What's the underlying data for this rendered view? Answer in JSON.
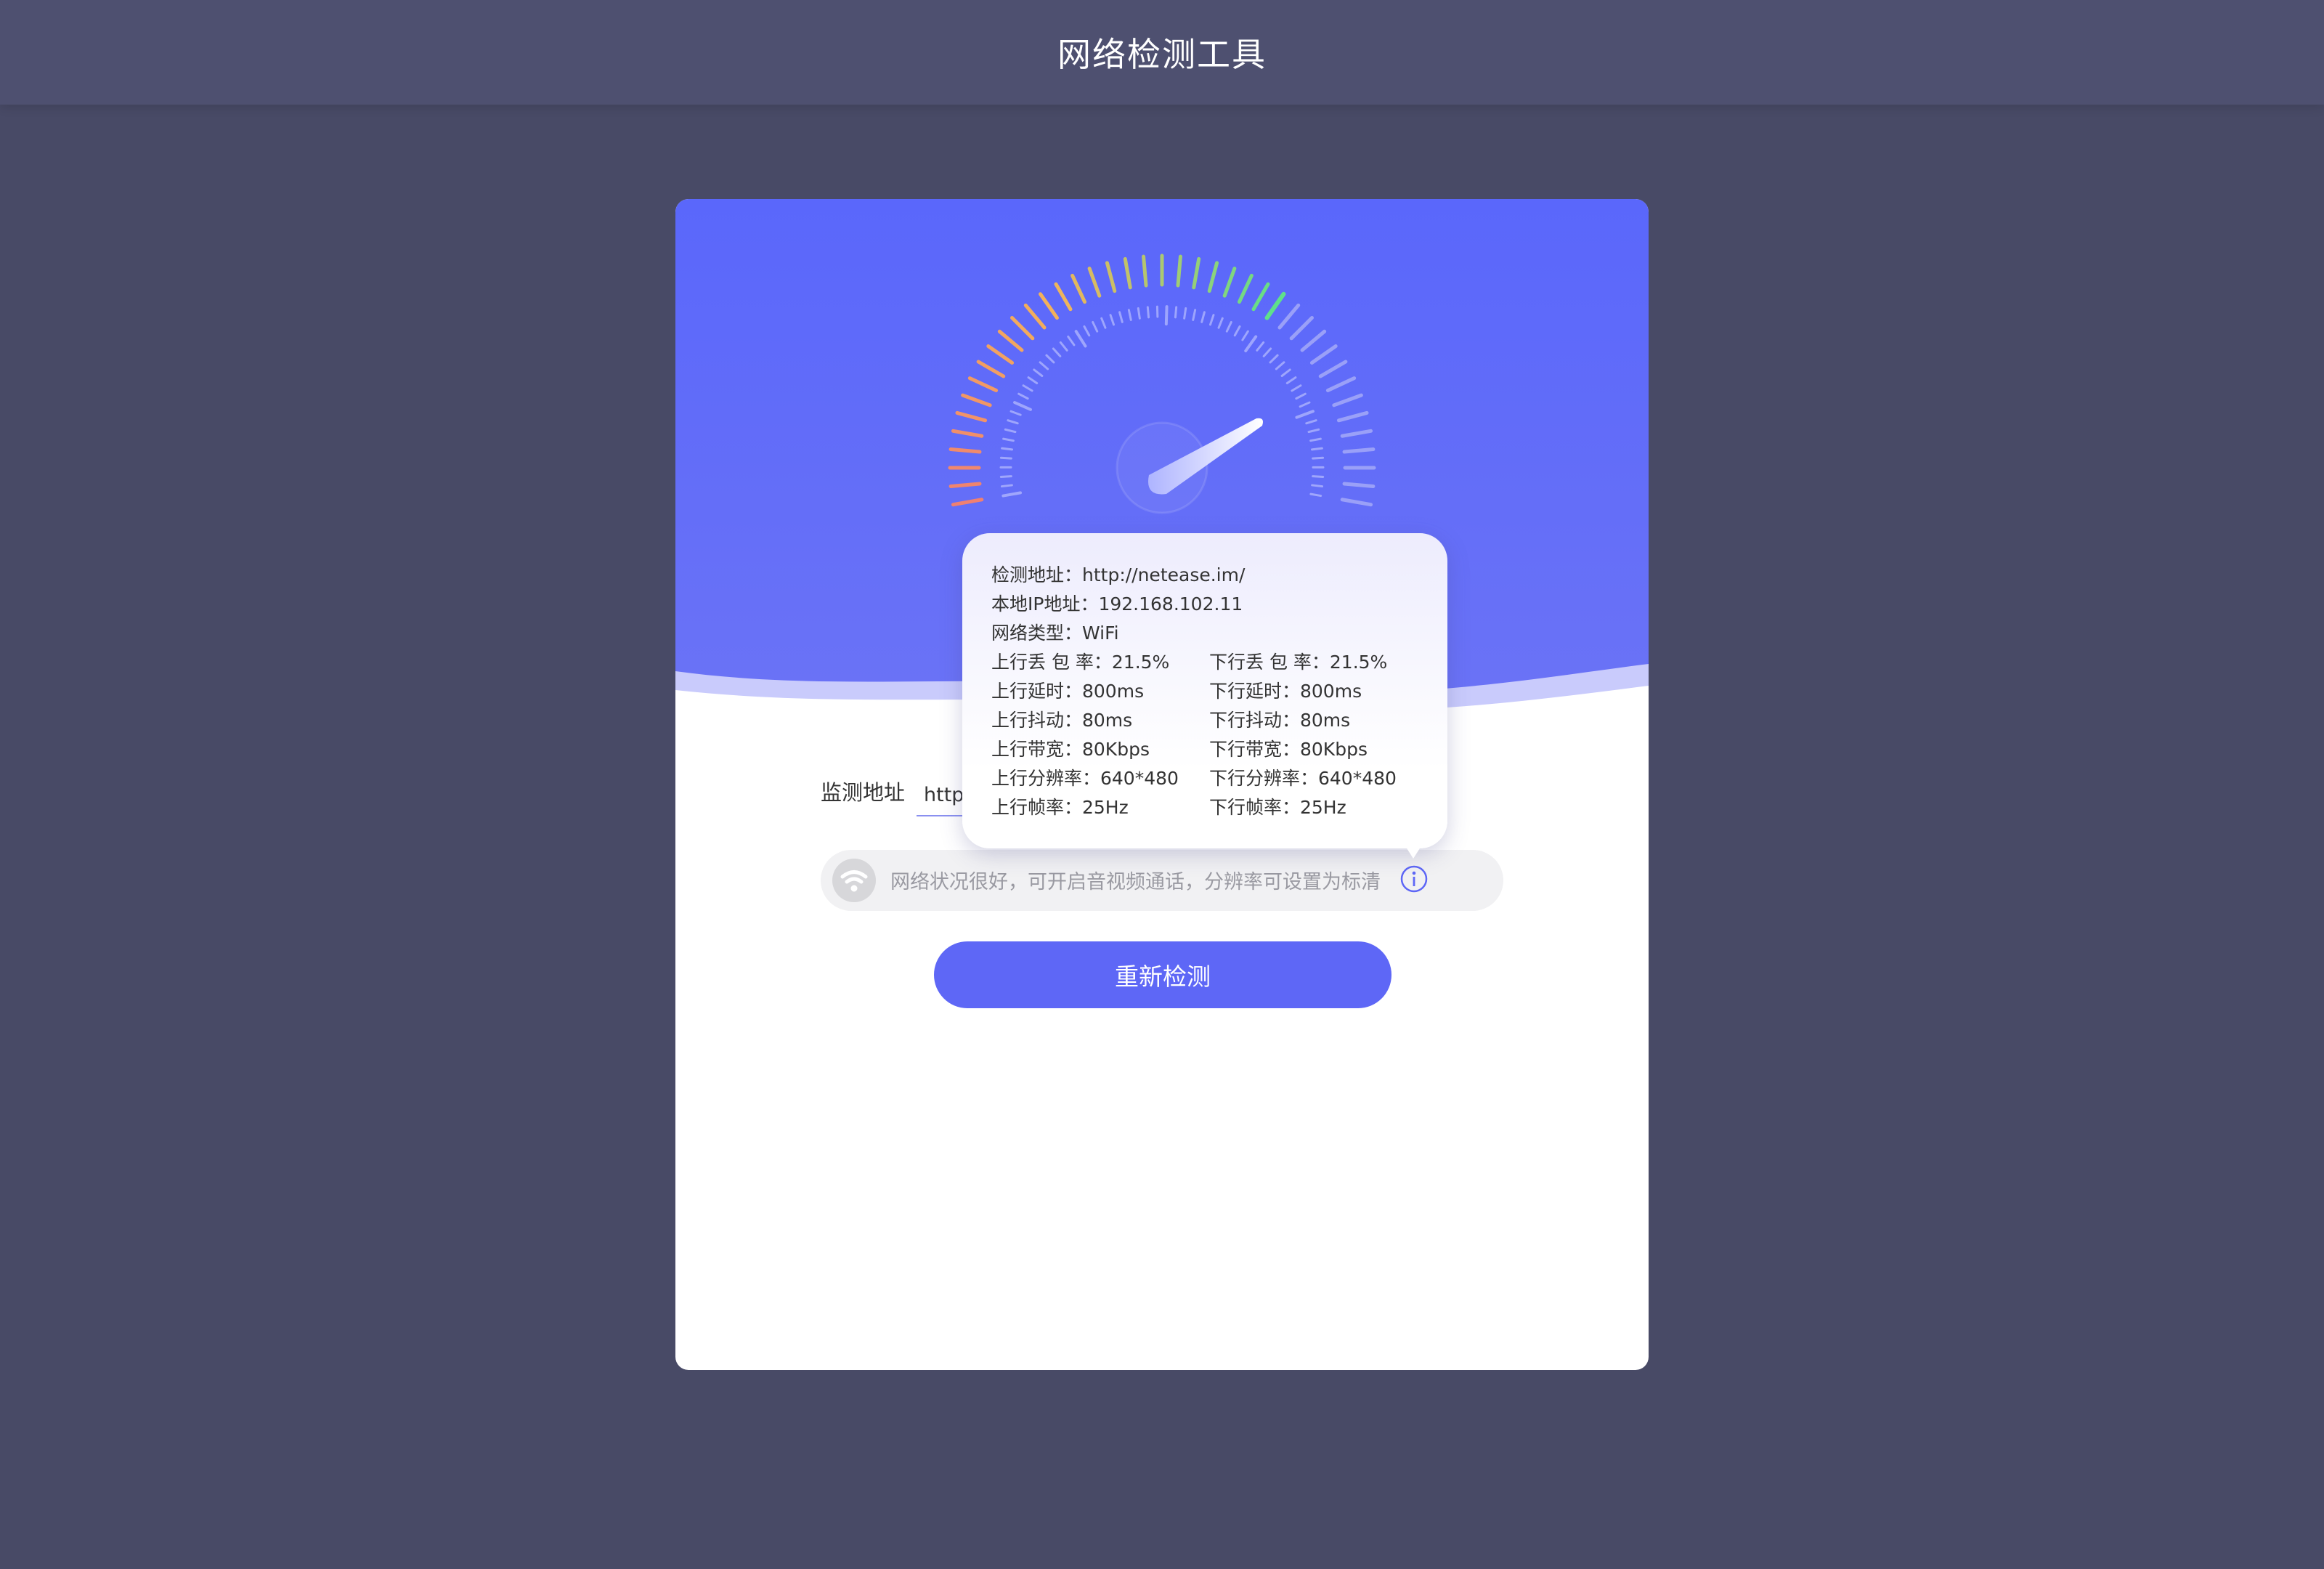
{
  "app": {
    "title": "网络检测工具"
  },
  "gauge": {
    "colors": {
      "low": "#f08070",
      "mid": "#f2b35a",
      "high": "#5fe08a",
      "inactive": "#9aa0f8"
    }
  },
  "monitor": {
    "label": "监测地址",
    "value": "http://netease.im/"
  },
  "status": {
    "icon": "wifi-icon",
    "text": "网络状况很好，可开启音视频通话，分辨率可设置为标清",
    "info_icon": "info-icon"
  },
  "actions": {
    "recheck_label": "重新检测"
  },
  "tooltip": {
    "address": "检测地址：http://netease.im/",
    "local_ip": "本地IP地址：192.168.102.11",
    "network_type": "网络类型：WiFi",
    "stats": [
      {
        "up": "上行丢 包 率：21.5%",
        "down": "下行丢 包 率：21.5%"
      },
      {
        "up": "上行延时：800ms",
        "down": "下行延时：800ms"
      },
      {
        "up": "上行抖动：80ms",
        "down": "下行抖动：80ms"
      },
      {
        "up": "上行带宽：80Kbps",
        "down": "下行带宽：80Kbps"
      },
      {
        "up": "上行分辨率：640*480",
        "down": "下行分辨率：640*480"
      },
      {
        "up": "上行帧率：25Hz",
        "down": "下行帧率：25Hz"
      }
    ]
  },
  "colors": {
    "page_bg": "#484a66",
    "header_bg": "#4e5070",
    "accent": "#5e67f6",
    "card_top": "#5a67fb"
  }
}
